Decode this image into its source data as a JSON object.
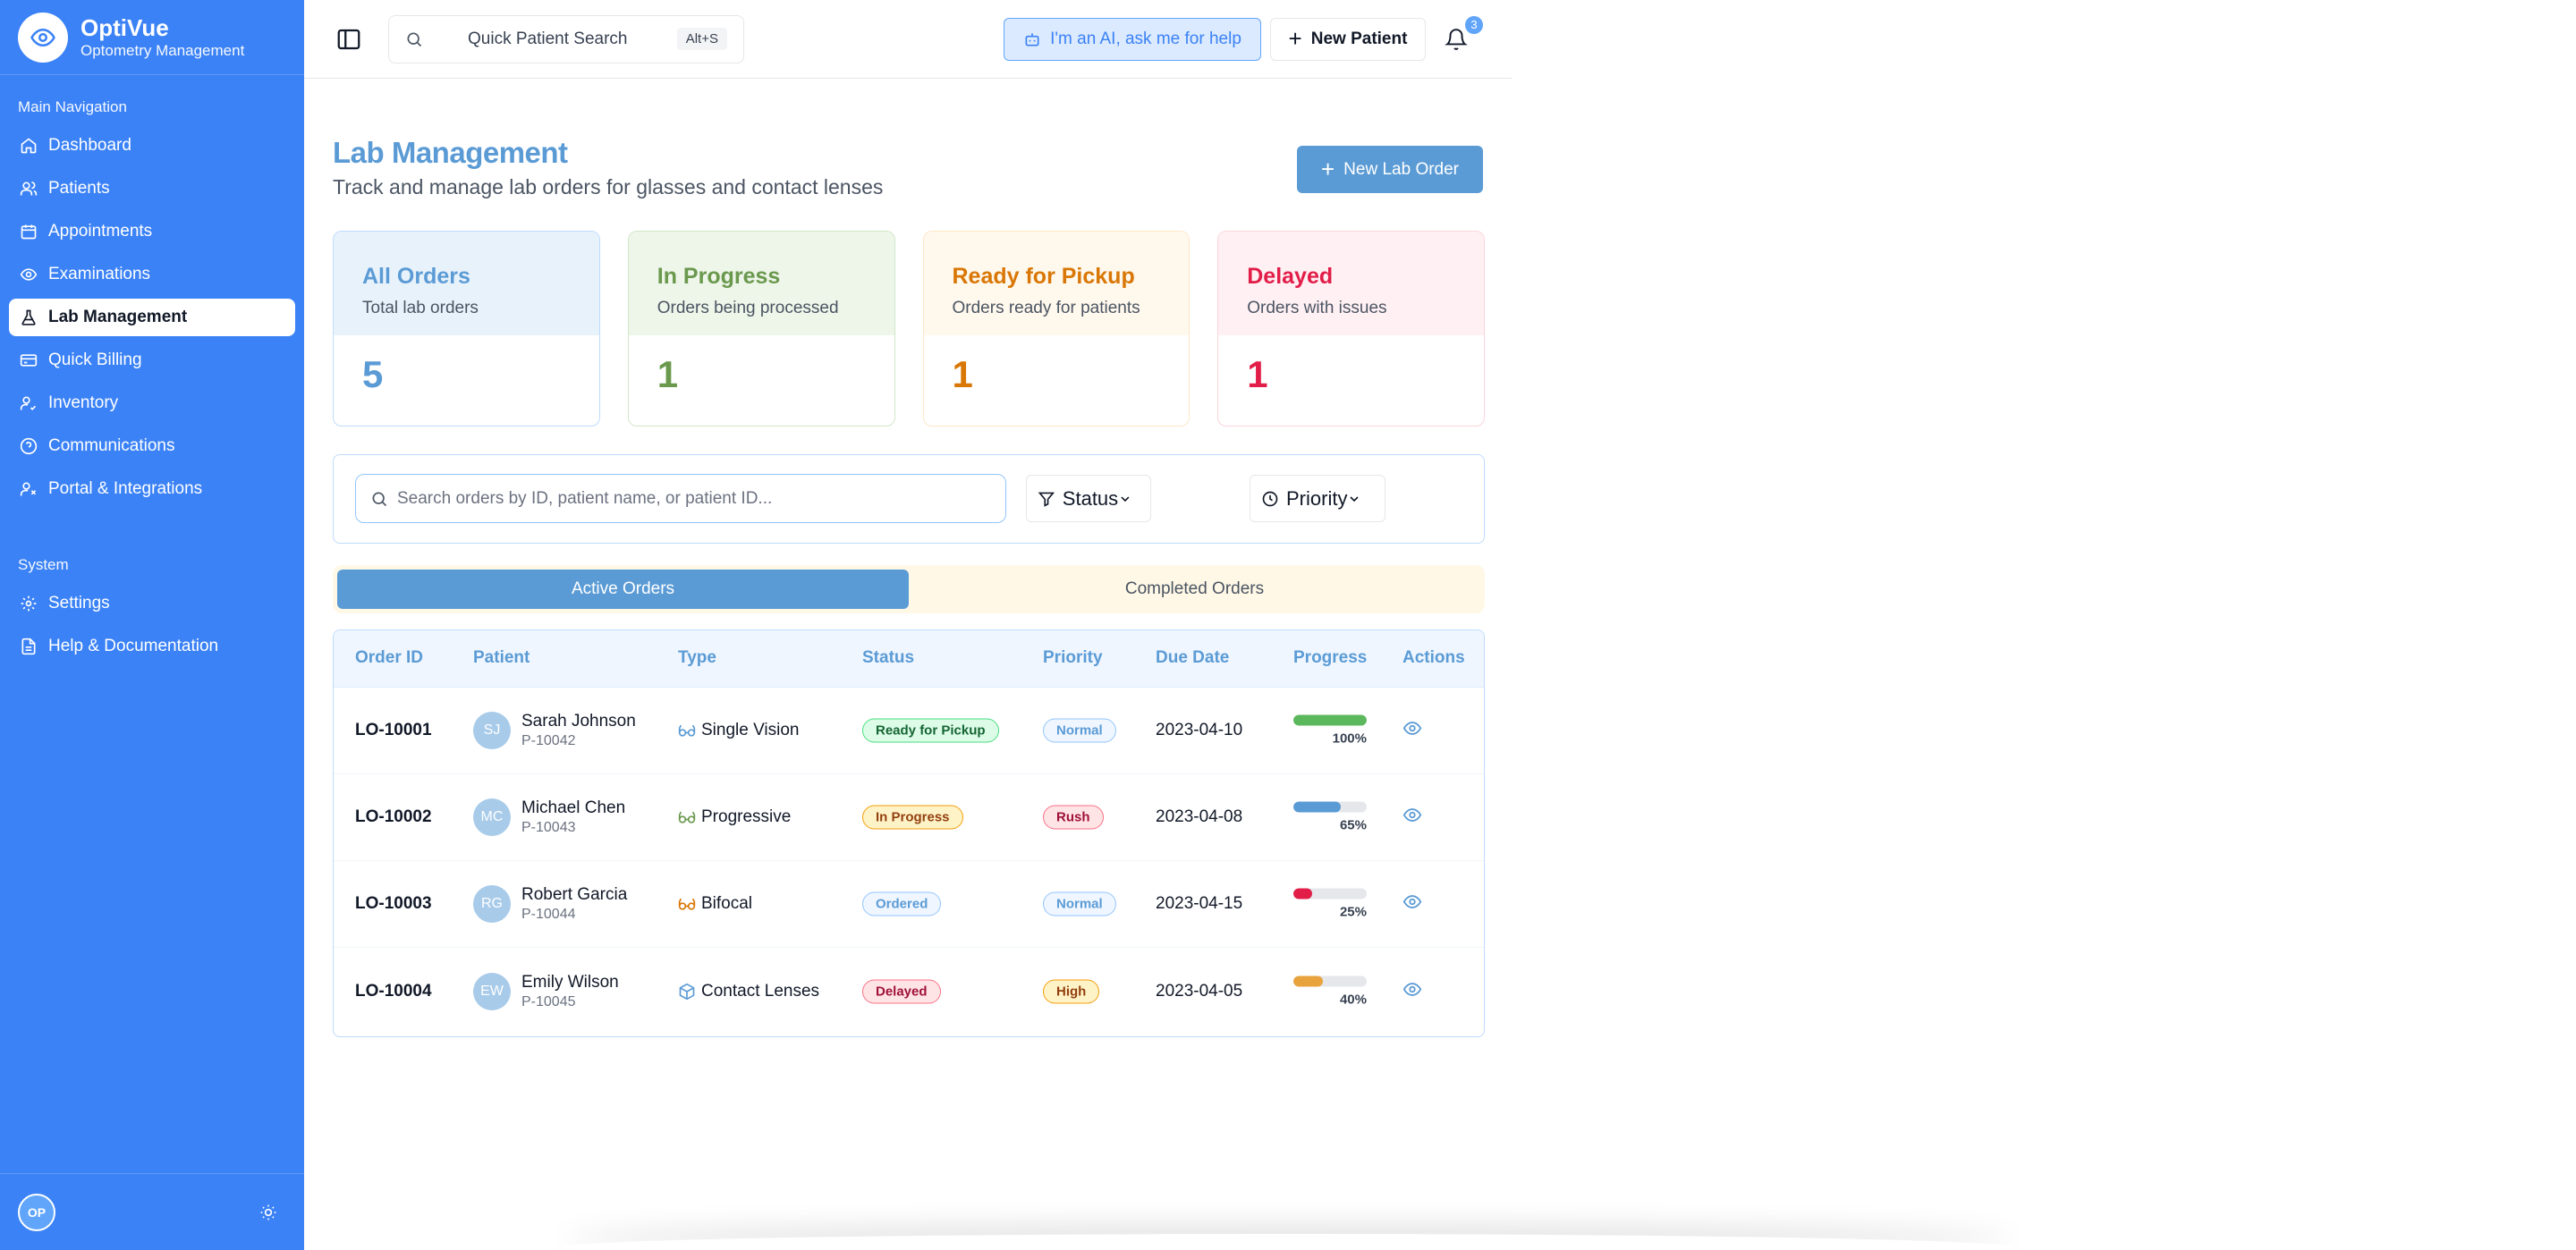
{
  "brand": {
    "name": "OptiVue",
    "subtitle": "Optometry Management"
  },
  "sidebar": {
    "main_label": "Main Navigation",
    "main_items": [
      {
        "label": "Dashboard",
        "icon": "home-icon"
      },
      {
        "label": "Patients",
        "icon": "users-icon"
      },
      {
        "label": "Appointments",
        "icon": "calendar-icon"
      },
      {
        "label": "Examinations",
        "icon": "eye-icon"
      },
      {
        "label": "Lab Management",
        "icon": "flask-icon",
        "active": true
      },
      {
        "label": "Quick Billing",
        "icon": "credit-card-icon"
      },
      {
        "label": "Inventory",
        "icon": "user-check-icon"
      },
      {
        "label": "Communications",
        "icon": "help-circle-icon"
      },
      {
        "label": "Portal & Integrations",
        "icon": "user-link-icon"
      }
    ],
    "system_label": "System",
    "system_items": [
      {
        "label": "Settings",
        "icon": "gear-icon"
      },
      {
        "label": "Help & Documentation",
        "icon": "document-icon"
      }
    ],
    "footer": {
      "avatar_initials": "OP"
    }
  },
  "topbar": {
    "search_label": "Quick Patient Search",
    "search_shortcut": "Alt+S",
    "ai_button": "I'm an AI, ask me for help",
    "new_patient": "New Patient",
    "notification_count": "3"
  },
  "page": {
    "title": "Lab Management",
    "subtitle": "Track and manage lab orders for glasses and contact lenses",
    "new_order_button": "New Lab Order"
  },
  "stats": [
    {
      "title": "All Orders",
      "desc": "Total lab orders",
      "value": "5"
    },
    {
      "title": "In Progress",
      "desc": "Orders being processed",
      "value": "1"
    },
    {
      "title": "Ready for Pickup",
      "desc": "Orders ready for patients",
      "value": "1"
    },
    {
      "title": "Delayed",
      "desc": "Orders with issues",
      "value": "1"
    }
  ],
  "filters": {
    "search_placeholder": "Search orders by ID, patient name, or patient ID...",
    "status_label": "Status",
    "priority_label": "Priority"
  },
  "tabs": {
    "active": "Active Orders",
    "completed": "Completed Orders"
  },
  "table": {
    "headers": [
      "Order ID",
      "Patient",
      "Type",
      "Status",
      "Priority",
      "Due Date",
      "Progress",
      "Actions"
    ],
    "rows": [
      {
        "order_id": "LO-10001",
        "initials": "SJ",
        "name": "Sarah Johnson",
        "patient_id": "P-10042",
        "type": "Single Vision",
        "type_icon": "glasses-icon",
        "type_color": "#5b9bd5",
        "status": "Ready for Pickup",
        "priority": "Normal",
        "due": "2023-04-10",
        "progress": 100,
        "progress_label": "100%",
        "progress_color": "#5cb85c"
      },
      {
        "order_id": "LO-10002",
        "initials": "MC",
        "name": "Michael Chen",
        "patient_id": "P-10043",
        "type": "Progressive",
        "type_icon": "glasses-icon",
        "type_color": "#6a994e",
        "status": "In Progress",
        "priority": "Rush",
        "due": "2023-04-08",
        "progress": 65,
        "progress_label": "65%",
        "progress_color": "#5b9bd5"
      },
      {
        "order_id": "LO-10003",
        "initials": "RG",
        "name": "Robert Garcia",
        "patient_id": "P-10044",
        "type": "Bifocal",
        "type_icon": "glasses-icon",
        "type_color": "#d97706",
        "status": "Ordered",
        "priority": "Normal",
        "due": "2023-04-15",
        "progress": 25,
        "progress_label": "25%",
        "progress_color": "#e11d48"
      },
      {
        "order_id": "LO-10004",
        "initials": "EW",
        "name": "Emily Wilson",
        "patient_id": "P-10045",
        "type": "Contact Lenses",
        "type_icon": "box-icon",
        "type_color": "#5b9bd5",
        "status": "Delayed",
        "priority": "High",
        "due": "2023-04-05",
        "progress": 40,
        "progress_label": "40%",
        "progress_color": "#e8a33d"
      }
    ]
  },
  "colors": {
    "sidebar": "#3b82f6",
    "accent": "#5b9bd5"
  }
}
